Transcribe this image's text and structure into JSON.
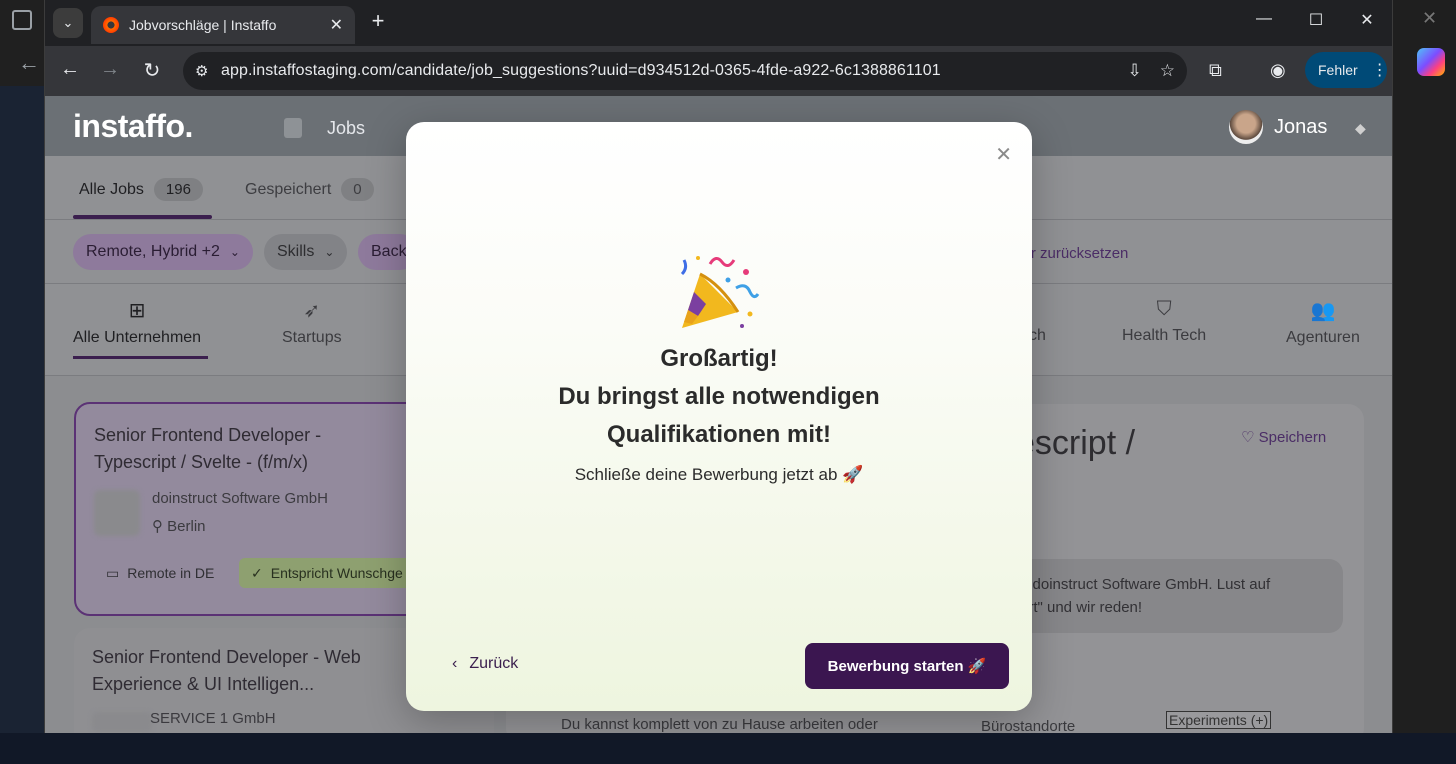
{
  "browser": {
    "tab_title": "Jobvorschläge | Instaffo",
    "url": "app.instaffostaging.com/candidate/job_suggestions?uuid=d934512d-0365-4fde-a922-6c1388861101",
    "profile_label": "Fehler"
  },
  "header": {
    "logo": "instaffo.",
    "nav_jobs": "Jobs",
    "user_name": "Jonas"
  },
  "subtabs": [
    {
      "label": "Alle Jobs",
      "count": "196"
    },
    {
      "label": "Gespeichert",
      "count": "0"
    }
  ],
  "filters": {
    "chips": [
      "Remote, Hybrid +2",
      "Skills",
      "Back"
    ],
    "reset": "lter zurücksetzen"
  },
  "categories": [
    "Alle Unternehmen",
    "Startups",
    "ch",
    "Health Tech",
    "Agenturen"
  ],
  "job_cards": [
    {
      "title": "Senior Frontend Developer - Typescript / Svelte - (f/m/x)",
      "company": "doinstruct Software GmbH",
      "location": "Berlin",
      "tag_remote": "Remote in DE",
      "tag_match": "Entspricht Wunschge"
    },
    {
      "title": "Senior Frontend Developer - Web Experience & UI Intelligen...",
      "company": "SERVICE 1 GmbH"
    }
  ],
  "detail": {
    "title_fragment": "escript /",
    "save": "Speichern",
    "box_line1": "n doinstruct Software GmbH. Lust auf",
    "box_line2": "ert\" und wir reden!",
    "foot_left": "Du kannst komplett von zu Hause arbeiten oder",
    "foot_right": "Bürostandorte",
    "experiments": "Experiments (+)"
  },
  "modal": {
    "heading_line1": "Großartig!",
    "heading_line2": "Du bringst alle notwendigen",
    "heading_line3": "Qualifikationen mit!",
    "subtitle": "Schließe deine Bewerbung jetzt ab 🚀",
    "back": "Zurück",
    "primary": "Bewerbung starten 🚀"
  },
  "colors": {
    "brand_purple": "#3b1650",
    "modal_bg_bottom": "#eef5df"
  }
}
